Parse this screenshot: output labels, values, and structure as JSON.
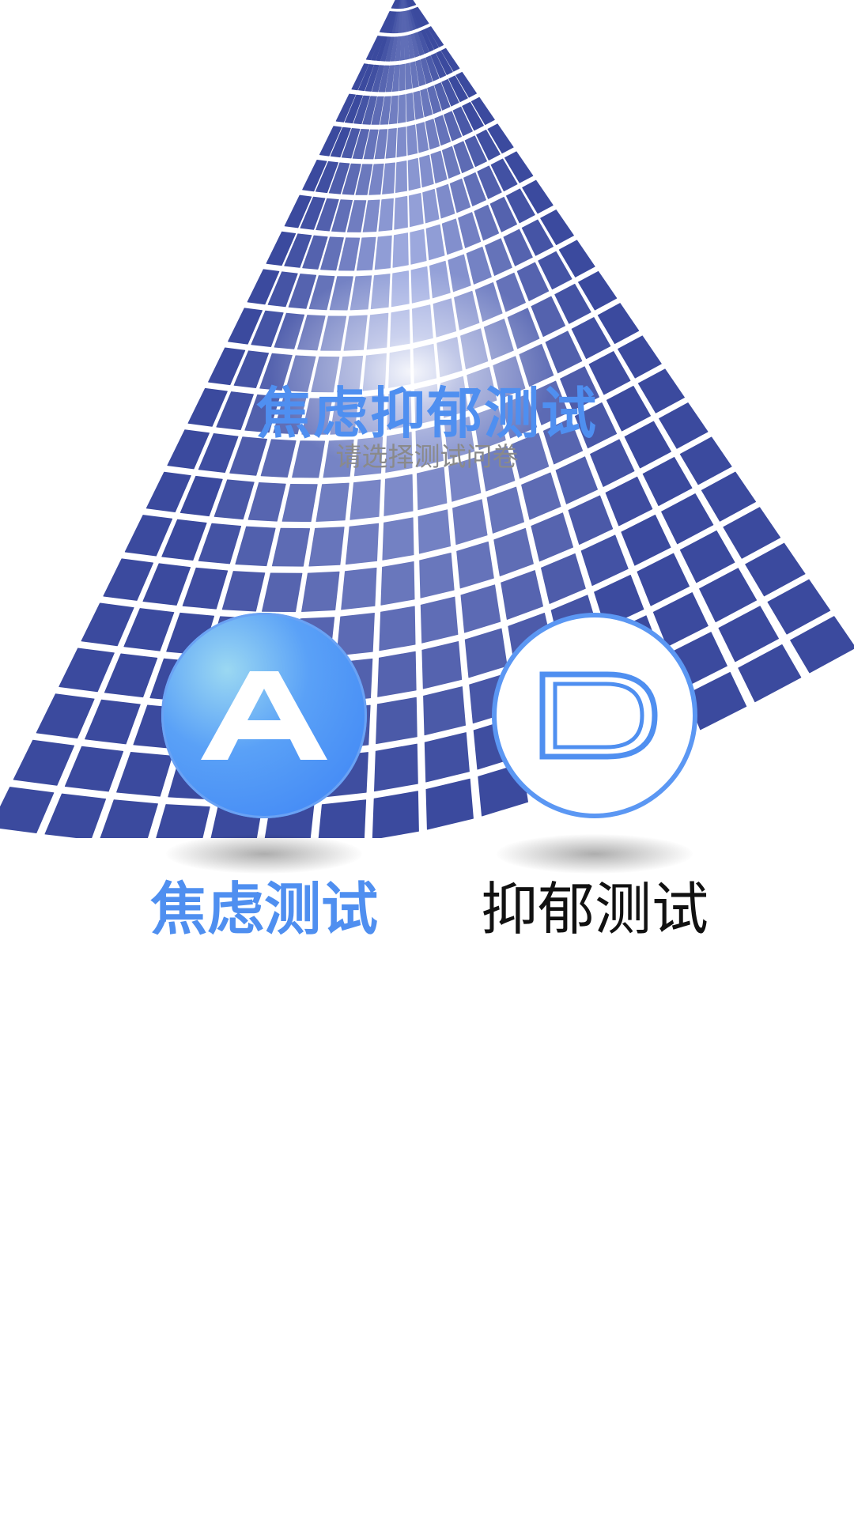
{
  "header": {
    "title": "焦虑抑郁测试",
    "subtitle": "请选择测试问卷"
  },
  "options": [
    {
      "letter": "A",
      "label": "焦虑测试",
      "selected": true
    },
    {
      "letter": "D",
      "label": "抑郁测试",
      "selected": false
    }
  ],
  "colors": {
    "accent": "#4f8ff0",
    "tile_dark": "#3b4a9e",
    "tile_light": "#a8b4e6",
    "subtitle": "#8a8a8a",
    "label_inactive": "#111111"
  },
  "icons": {
    "hero": "tiled-wave-graphic",
    "option_a": "letter-a-icon",
    "option_d": "letter-d-icon"
  }
}
